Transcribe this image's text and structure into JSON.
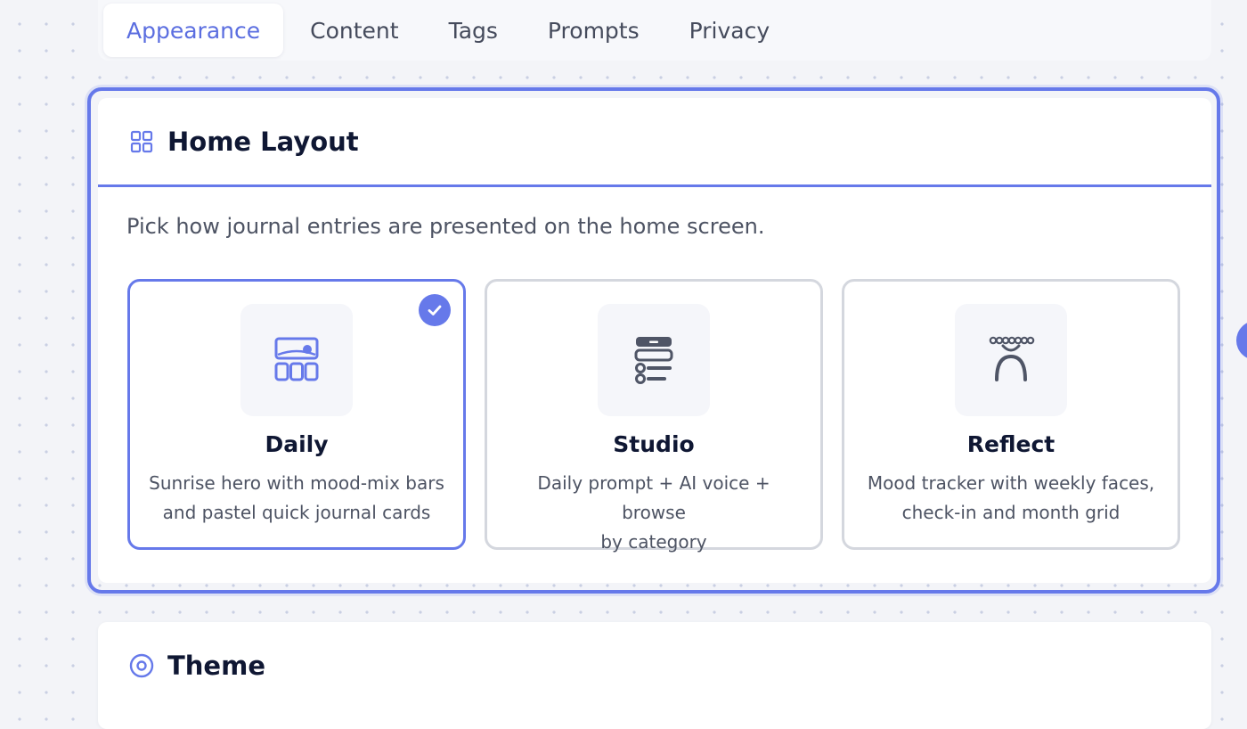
{
  "tabs": [
    {
      "label": "Appearance",
      "active": true
    },
    {
      "label": "Content",
      "active": false
    },
    {
      "label": "Tags",
      "active": false
    },
    {
      "label": "Prompts",
      "active": false
    },
    {
      "label": "Privacy",
      "active": false
    }
  ],
  "home_layout": {
    "title": "Home Layout",
    "icon": "grid-icon",
    "description": "Pick how journal entries are presented on the home screen.",
    "selected": "Daily",
    "options": [
      {
        "title": "Daily",
        "icon": "daily-layout-icon",
        "description_line1": "Sunrise hero with mood-mix bars",
        "description_line2": "and pastel quick journal cards"
      },
      {
        "title": "Studio",
        "icon": "studio-layout-icon",
        "description_line1": "Daily prompt + AI voice + browse",
        "description_line2": "by category"
      },
      {
        "title": "Reflect",
        "icon": "reflect-layout-icon",
        "description_line1": "Mood tracker with weekly faces,",
        "description_line2": "check-in and month grid"
      }
    ]
  },
  "theme": {
    "title": "Theme",
    "icon": "target-icon"
  },
  "colors": {
    "accent": "#6679ea",
    "title": "#0f1733",
    "muted": "#4d5363",
    "border": "#d4d7de"
  }
}
